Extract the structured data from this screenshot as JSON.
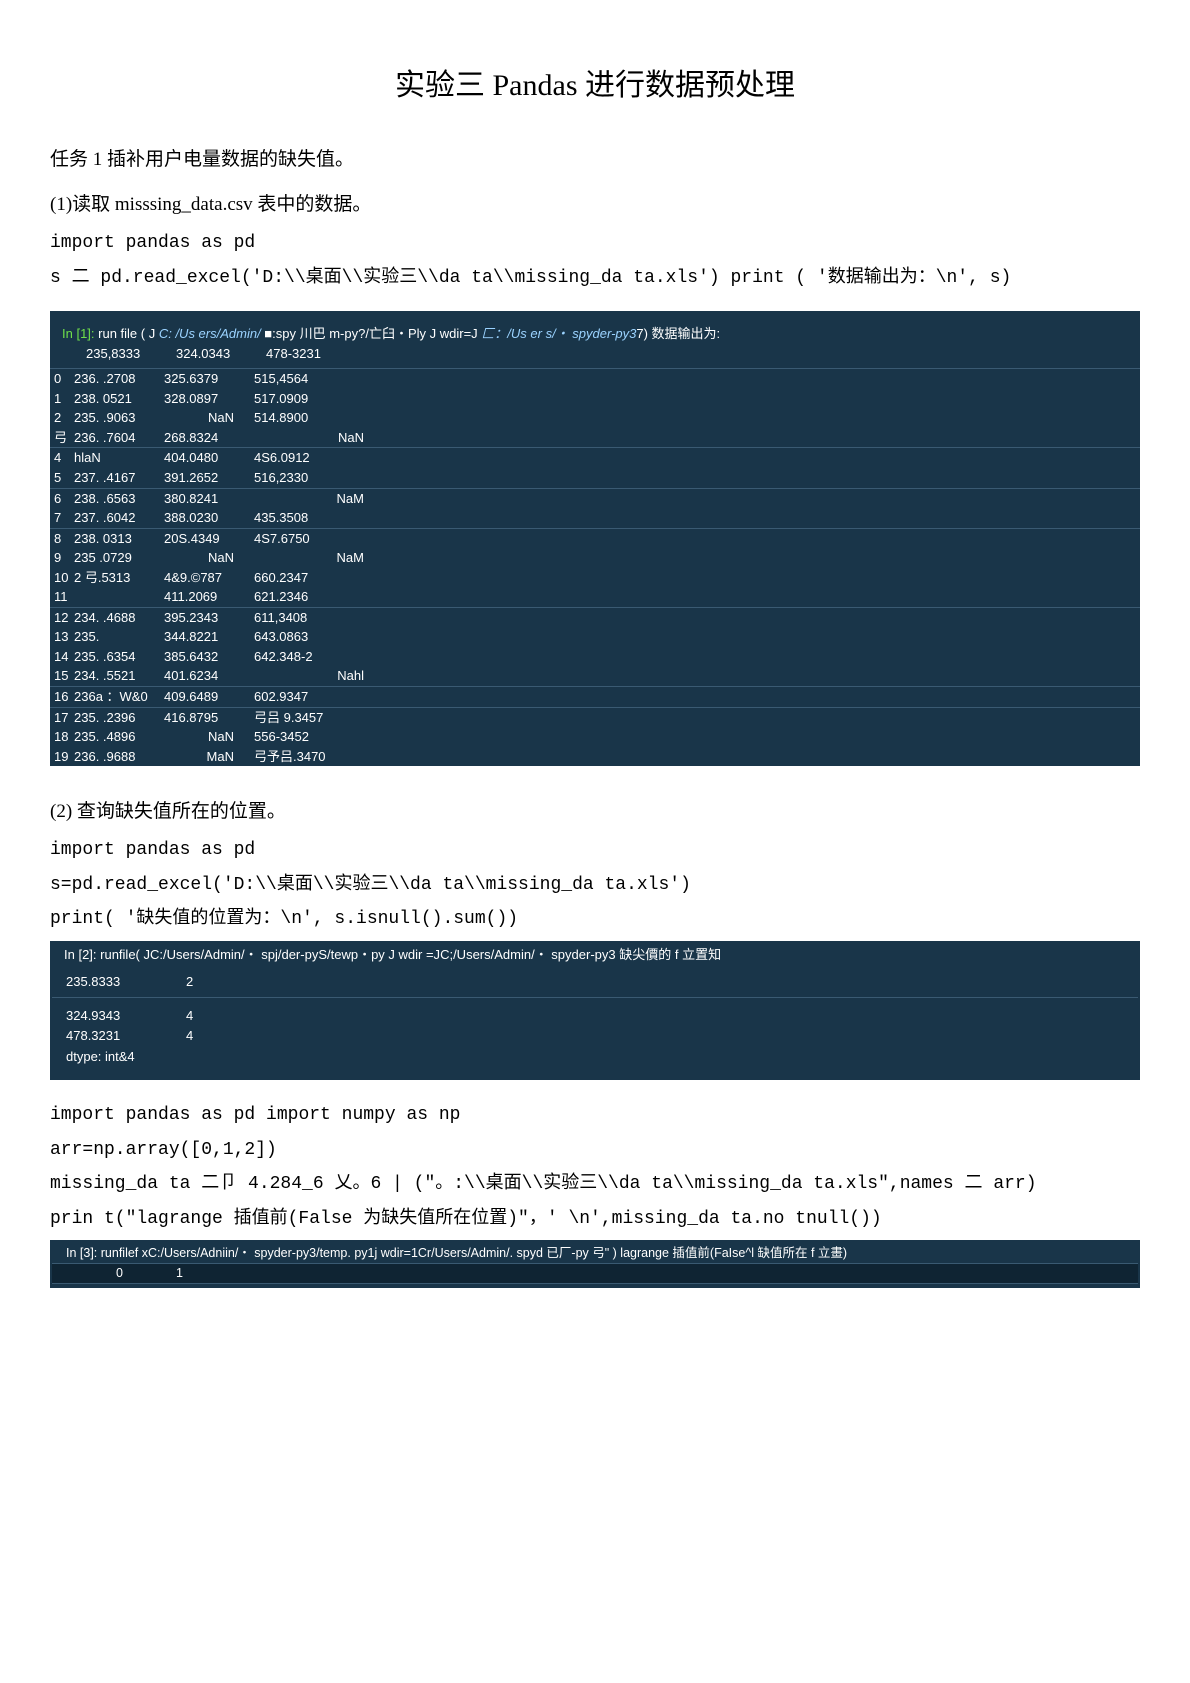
{
  "title": "实验三 Pandas 进行数据预处理",
  "task1": "任务  1 插补用户电量数据的缺失值。",
  "step1": "(1)读取 misssing_data.csv 表中的数据。",
  "code1a": "import pandas as pd",
  "code1b": "s 二 pd.read_excel('D:\\\\桌面\\\\实验三\\\\da ta\\\\missing_da ta.xls') print ( '数据输出为：\\n', s)",
  "con1": {
    "prompt_pre": "In [1]:",
    "prompt_mid1": " run file ( J ",
    "prompt_path1": "C: /Us ers/Admin/",
    "prompt_mid2": " ■:spy 川巴 m-py?/亡臼・Ply J wdir=J ",
    "prompt_path2": "匚：/Us er s/・ spyder-py3",
    "prompt_mid3": "7) 数据输出为:",
    "head": [
      "",
      "235,8333",
      "324.0343",
      "478-3231"
    ],
    "rows": [
      [
        "0",
        "236. .2708",
        "325.6379",
        "515,4564"
      ],
      [
        "1",
        "238. 0521",
        "328.0897",
        "517.0909"
      ],
      [
        "2",
        "235. .9063",
        "NaN",
        "514.8900"
      ],
      [
        "弓",
        "236. .7604",
        "268.8324",
        "NaN"
      ],
      [
        "4",
        "hlaN",
        "404.0480",
        "4S6.0912"
      ],
      [
        "5",
        "237. .4167",
        "391.2652",
        "516,2330"
      ],
      [
        "6",
        "238. .6563",
        "380.8241",
        "NaM"
      ],
      [
        "7",
        "237. .6042",
        "388.0230",
        "435.3508"
      ],
      [
        "8",
        "238. 0313",
        "20S.4349",
        "4S7.6750"
      ],
      [
        "9",
        "235 .0729",
        "NaN",
        "NaM"
      ],
      [
        "10",
        "2  弓.5313",
        "4&9.©787",
        "660.2347"
      ],
      [
        "11",
        "",
        "411.2069",
        "621.2346"
      ],
      [
        "12",
        "234. .4688",
        "395.2343",
        "611,3408"
      ],
      [
        " 13",
        "235.",
        "344.8221",
        "643.0863"
      ],
      [
        "14",
        "235. .6354",
        "385.6432",
        "642.348-2"
      ],
      [
        " 15",
        "234. .5521",
        "401.6234",
        "Nahl"
      ],
      [
        "16",
        "236a ：W&0",
        "409.6489",
        "602.9347"
      ],
      [
        "17",
        "235. .2396",
        "416.8795",
        "弓吕 9.3457"
      ],
      [
        "18",
        "235. .4896",
        "NaN",
        "556-3452"
      ],
      [
        " 19",
        "236. .9688",
        "MaN",
        "弓予吕.3470"
      ]
    ]
  },
  "step2": "(2)   查询缺失值所在的位置。",
  "code2a": "import pandas as pd",
  "code2b": "s=pd.read_excel('D:\\\\桌面\\\\实验三\\\\da ta\\\\missing_da ta.xls')",
  "code2c": "print( '缺失值的位置为：\\n', s.isnull().sum())",
  "con2": {
    "prompt_pre": "In [2]:",
    "prompt_mid1": " runfile( J",
    "prompt_path1": "C:/Users/Admin/・ spj/der-pyS/tewp・py",
    "prompt_mid2": " J wdir =J",
    "prompt_path2": "C;/Users/Admin/・ spyder-py3",
    "tail": " 缺尖價的 f 立置知",
    "rows": [
      [
        "235.8333",
        "2"
      ],
      [
        "",
        ""
      ],
      [
        "324.9343",
        "4"
      ],
      [
        "478.3231",
        "4"
      ]
    ],
    "dtype": "dtype: int&4"
  },
  "code3a": "import pandas as pd import numpy as np",
  "code3b": "arr=np.array([0,1,2])",
  "code3c": "missing_da ta 二卩 4.284_6 乂。6 | (\"。:\\\\桌面\\\\实验三\\\\da ta\\\\missing_da ta.xls\",names 二 arr)",
  "code3d": "prin t(\"lagrange 插值前(False 为缺失值所在位置)\"，' \\n',missing_da ta.no tnull())",
  "con3": {
    "prompt_pre": "In [3]:",
    "prompt_mid1": " runfilef x",
    "prompt_path1": "C:/Users/Adniin/・ spyder-py3/temp. py",
    "prompt_mid2": "1j wdir=1",
    "prompt_path2": "Cr/Users/Admin/. spyd 已厂-py 弓\" )",
    "tail": " lagrange 插值前(FaIse^l 缺值所在 f 立畫)",
    "cols": [
      "",
      "0",
      "1"
    ]
  }
}
